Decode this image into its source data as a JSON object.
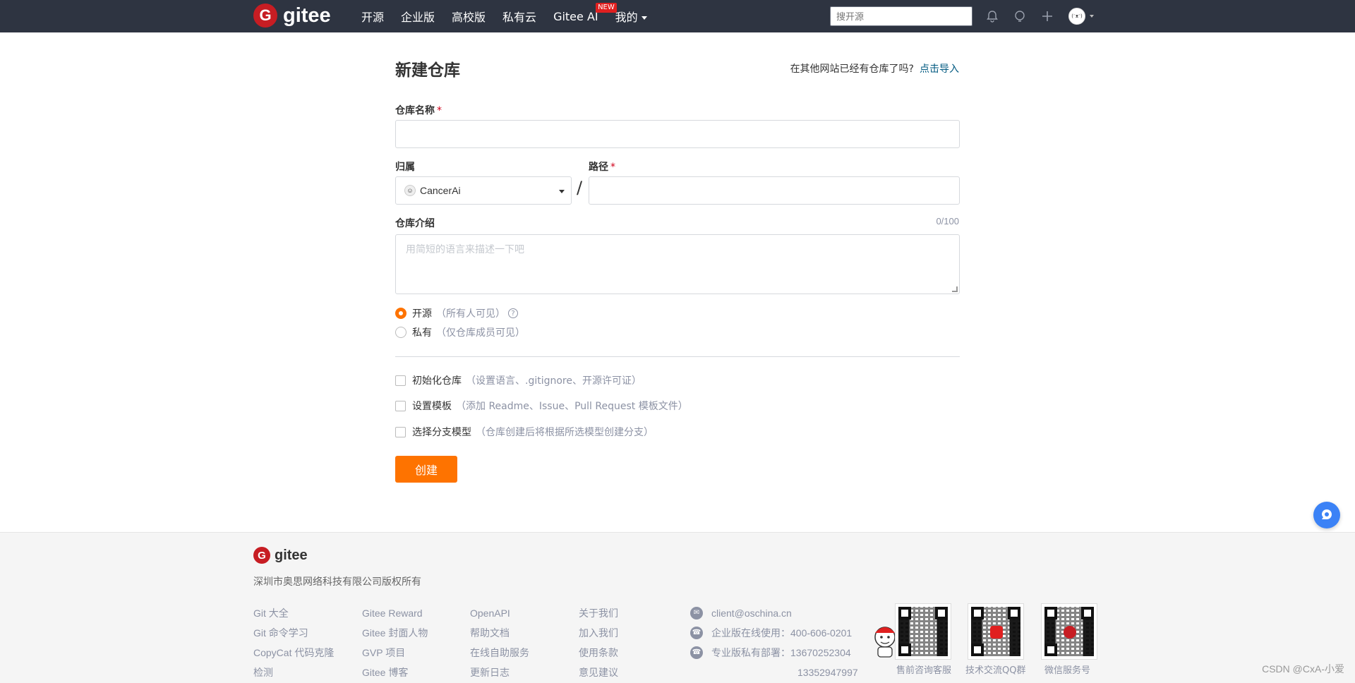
{
  "topnav": {
    "brand": "gitee",
    "logo_letter": "G",
    "links": [
      "开源",
      "企业版",
      "高校版",
      "私有云",
      "Gitee AI",
      "我的"
    ],
    "new_badge": "NEW",
    "search_placeholder": "搜开源",
    "icons": [
      "bell-icon",
      "lightbulb-icon",
      "plus-icon"
    ],
    "avatar_caption": "(ᵔᴥᵔ)"
  },
  "form": {
    "title": "新建仓库",
    "import_prompt": "在其他网站已经有仓库了吗?",
    "import_link": "点击导入",
    "repo_name_label": "仓库名称",
    "required_mark": "*",
    "owner_label": "归属",
    "owner_value": "CancerAi",
    "path_label": "路径",
    "slash": "/",
    "description_label": "仓库介绍",
    "description_counter": "0/100",
    "description_placeholder": "用简短的语言来描述一下吧",
    "visibility": [
      {
        "label": "开源",
        "hint": "（所有人可见）",
        "selected": true
      },
      {
        "label": "私有",
        "hint": "（仅仓库成员可见）",
        "selected": false
      }
    ],
    "options": [
      {
        "label": "初始化仓库",
        "hint": "（设置语言、.gitignore、开源许可证）",
        "checked": false
      },
      {
        "label": "设置模板",
        "hint": "（添加 Readme、Issue、Pull Request 模板文件）",
        "checked": false
      },
      {
        "label": "选择分支模型",
        "hint": "（仓库创建后将根据所选模型创建分支）",
        "checked": false
      }
    ],
    "submit_label": "创建",
    "accent_color": "#fe7300"
  },
  "footer": {
    "brand": "gitee",
    "company": "深圳市奥思网络科技有限公司版权所有",
    "columns": [
      [
        "Git 大全",
        "Git 命令学习",
        "CopyCat 代码克隆",
        "检测"
      ],
      [
        "Gitee Reward",
        "Gitee 封面人物",
        "GVP 项目",
        "Gitee 博客"
      ],
      [
        "OpenAPI",
        "帮助文档",
        "在线自助服务",
        "更新日志"
      ],
      [
        "关于我们",
        "加入我们",
        "使用条款",
        "意见建议"
      ]
    ],
    "contact": {
      "email": "client@oschina.cn",
      "enterprise": "企业版在线使用：400-606-0201",
      "private": "专业版私有部署：13670252304",
      "private_extra": "13352947997"
    },
    "qr_labels": [
      "售前咨询客服",
      "技术交流QQ群",
      "微信服务号"
    ]
  },
  "watermark": "CSDN @CxA-小爱"
}
